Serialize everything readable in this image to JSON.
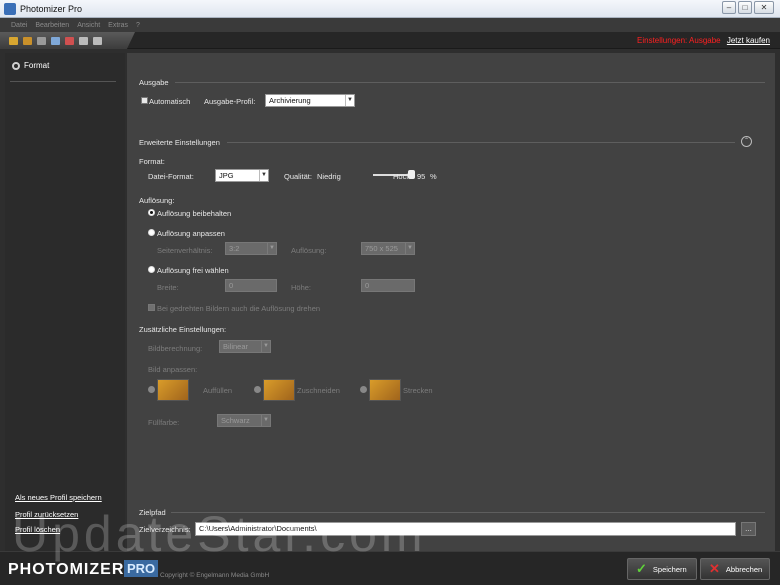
{
  "window": {
    "title": "Photomizer Pro",
    "minimize": "–",
    "maximize": "□",
    "close": "✕"
  },
  "menu": [
    "Datei",
    "Bearbeiten",
    "Ansicht",
    "Extras",
    "?"
  ],
  "toolbar": {
    "notice": "Einstellungen: Ausgabe",
    "buy_link": "Jetzt kaufen"
  },
  "sidebar": {
    "active_item": "Format",
    "links": {
      "save_new": "Als neues Profil speichern",
      "reset": "Profil zurücksetzen",
      "delete": "Profil löschen"
    }
  },
  "output": {
    "heading": "Ausgabe",
    "auto_label": "Automatisch",
    "profile_label": "Ausgabe-Profil:",
    "profile_value": "Archivierung"
  },
  "advanced": {
    "heading": "Erweiterte Einstellungen",
    "collapse": "⌃",
    "format_heading": "Format:",
    "file_format_label": "Datei-Format:",
    "file_format_value": "JPG",
    "quality_label": "Qualität:",
    "quality_low": "Niedrig",
    "quality_high": "Hoch",
    "quality_value": "95",
    "quality_unit": "%",
    "quality_fraction": 0.95,
    "resolution_heading": "Auflösung:",
    "keep_res": "Auflösung beibehalten",
    "adjust_res": "Auflösung anpassen",
    "aspect_label": "Seitenverhältnis:",
    "aspect_value": "3:2",
    "res_label": "Auflösung:",
    "res_value": "750 x 525",
    "free_res": "Auflösung frei wählen",
    "width_label": "Breite:",
    "width_value": "0",
    "height_label": "Höhe:",
    "height_value": "0",
    "rotate_label": "Bei gedrehten Bildern auch die Auflösung drehen",
    "extra_heading": "Zusätzliche Einstellungen:",
    "calc_label": "Bildberechnung:",
    "calc_value": "Bilinear",
    "fit_label": "Bild anpassen:",
    "fit_fill": "Auffüllen",
    "fit_crop": "Zuschneiden",
    "fit_stretch": "Strecken",
    "fill_color_label": "Füllfarbe:",
    "fill_color_value": "Schwarz"
  },
  "target": {
    "heading": "Zielpfad",
    "dir_label": "Zielverzeichnis:",
    "dir_value": "C:\\Users\\Administrator\\Documents\\",
    "browse": "..."
  },
  "footer": {
    "brand": "PHOTOMIZER",
    "brand_pro": "PRO",
    "copyright": "Copyright © Engelmann Media GmbH",
    "save": "Speichern",
    "cancel": "Abbrechen"
  },
  "watermark": "UpdateStar.com"
}
